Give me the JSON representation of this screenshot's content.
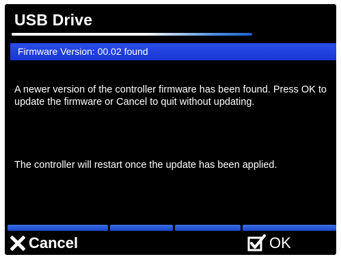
{
  "dialog": {
    "title": "USB Drive",
    "banner": "Firmware Version: 00.02 found",
    "message_line1": "A newer version of the controller firmware has been found. Press OK to update the firmware or Cancel to quit without updating.",
    "message_line2": "The controller will restart once the update has been applied."
  },
  "softkeys": {
    "cancel_label": "Cancel",
    "ok_label": "OK"
  },
  "colors": {
    "background": "#000000",
    "banner": "#1e3fdd",
    "softkey_bar": "#2a5ad8",
    "text": "#ffffff"
  },
  "icons": {
    "cancel": "close-x-icon",
    "ok": "checkbox-check-icon"
  }
}
